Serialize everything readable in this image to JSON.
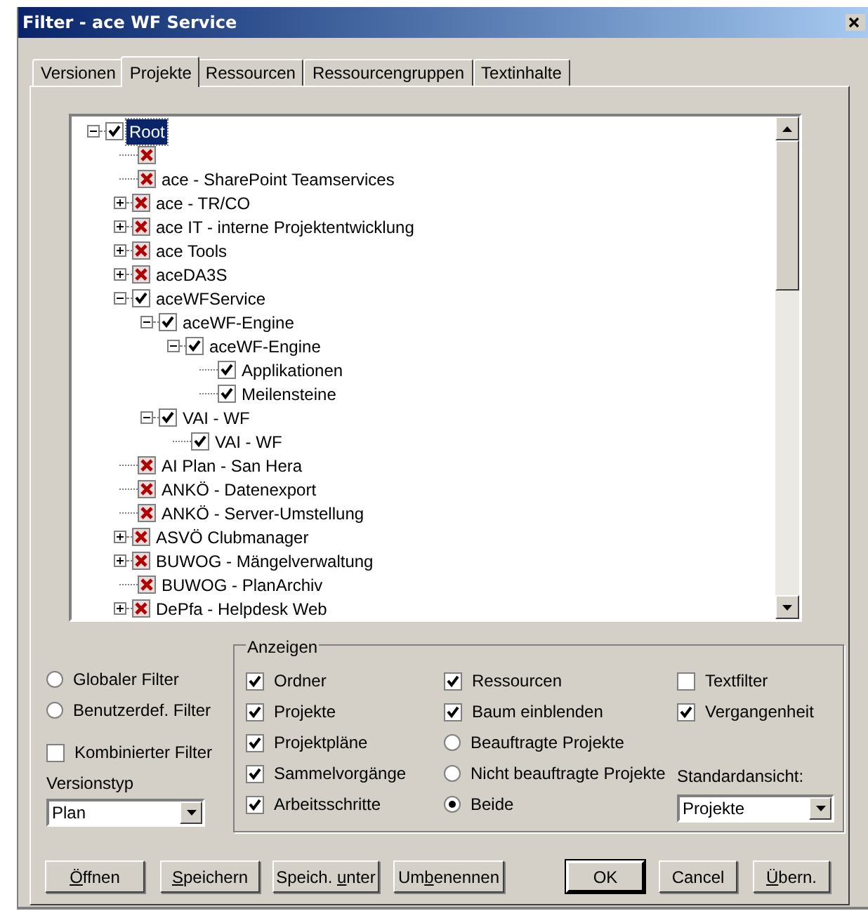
{
  "window": {
    "title": "Filter - ace WF Service"
  },
  "tabs": [
    {
      "label": "Versionen",
      "selected": false
    },
    {
      "label": "Projekte",
      "selected": true
    },
    {
      "label": "Ressourcen",
      "selected": false
    },
    {
      "label": "Ressourcengruppen",
      "selected": false
    },
    {
      "label": "Textinhalte",
      "selected": false
    }
  ],
  "tree": [
    {
      "label": "Root",
      "checked": true,
      "excluded": false,
      "expanded": true,
      "selected": true,
      "children": [
        {
          "checked": false,
          "excluded": true
        },
        {
          "label": "ace - SharePoint Teamservices",
          "checked": false,
          "excluded": true,
          "selected": false
        },
        {
          "label": "ace - TR/CO",
          "checked": false,
          "excluded": true,
          "expanded": false,
          "selected": false
        },
        {
          "label": "ace IT - interne Projektentwicklung",
          "checked": false,
          "excluded": true,
          "expanded": false,
          "selected": false
        },
        {
          "label": "ace Tools",
          "checked": false,
          "excluded": true,
          "expanded": false,
          "selected": false
        },
        {
          "label": "aceDA3S",
          "checked": false,
          "excluded": true,
          "expanded": false,
          "selected": false
        },
        {
          "label": "aceWFService",
          "checked": true,
          "excluded": false,
          "expanded": true,
          "selected": false,
          "children": [
            {
              "label": "aceWF-Engine",
              "checked": true,
              "excluded": false,
              "expanded": true,
              "selected": false,
              "children": [
                {
                  "label": "aceWF-Engine",
                  "checked": true,
                  "excluded": false,
                  "expanded": true,
                  "selected": false,
                  "children": [
                    {
                      "label": "Applikationen",
                      "checked": true,
                      "excluded": false,
                      "selected": false
                    },
                    {
                      "label": "Meilensteine",
                      "checked": true,
                      "excluded": false,
                      "selected": false
                    }
                  ]
                }
              ]
            },
            {
              "label": "VAI - WF",
              "checked": true,
              "excluded": false,
              "expanded": true,
              "selected": false,
              "children": [
                {
                  "label": "VAI - WF",
                  "checked": true,
                  "excluded": false,
                  "selected": false
                }
              ]
            }
          ]
        },
        {
          "label": "AI Plan - San Hera",
          "checked": false,
          "excluded": true,
          "selected": false
        },
        {
          "label": "ANKÖ - Datenexport",
          "checked": false,
          "excluded": true,
          "selected": false
        },
        {
          "label": "ANKÖ - Server-Umstellung",
          "checked": false,
          "excluded": true,
          "selected": false
        },
        {
          "label": "ASVÖ Clubmanager",
          "checked": false,
          "excluded": true,
          "expanded": false,
          "selected": false
        },
        {
          "label": "BUWOG - Mängelverwaltung",
          "checked": false,
          "excluded": true,
          "expanded": false,
          "selected": false
        },
        {
          "label": "BUWOG - PlanArchiv",
          "checked": false,
          "excluded": true,
          "selected": false
        },
        {
          "label": "DePfa - Helpdesk Web",
          "checked": false,
          "excluded": true,
          "expanded": false,
          "selected": false
        }
      ]
    }
  ],
  "left_options": [
    {
      "kind": "radio",
      "label": "Globaler Filter",
      "selected": false
    },
    {
      "kind": "radio",
      "label": "Benutzerdef. Filter",
      "selected": false
    },
    {
      "kind": "checkbox",
      "label": "Kombinierter Filter",
      "checked": false
    },
    {
      "kind": "label",
      "label": "Versionstyp"
    },
    {
      "kind": "select",
      "value": "Plan"
    }
  ],
  "display_group": {
    "title": "Anzeigen",
    "columns": [
      [
        {
          "kind": "checkbox",
          "label": "Ordner",
          "checked": true
        },
        {
          "kind": "checkbox",
          "label": "Projekte",
          "checked": true
        },
        {
          "kind": "checkbox",
          "label": "Projektpläne",
          "checked": true
        },
        {
          "kind": "checkbox",
          "label": "Sammelvorgänge",
          "checked": true
        },
        {
          "kind": "checkbox",
          "label": "Arbeitsschritte",
          "checked": true
        }
      ],
      [
        {
          "kind": "checkbox",
          "label": "Ressourcen",
          "checked": true
        },
        {
          "kind": "checkbox",
          "label": "Baum einblenden",
          "checked": true
        },
        {
          "kind": "radio",
          "label": "Beauftragte Projekte",
          "selected": false
        },
        {
          "kind": "radio",
          "label": "Nicht beauftragte Projekte",
          "selected": false
        },
        {
          "kind": "radio",
          "label": "Beide",
          "selected": true
        }
      ],
      [
        {
          "kind": "checkbox",
          "label": "Textfilter",
          "checked": false
        },
        {
          "kind": "checkbox",
          "label": "Vergangenheit",
          "checked": true
        },
        {
          "kind": "label",
          "label": "Standardansicht:"
        },
        {
          "kind": "select",
          "value": "Projekte"
        }
      ]
    ]
  },
  "buttons": [
    {
      "access_key": "Ö",
      "label_after": "ffnen",
      "default": false
    },
    {
      "access_key": "S",
      "label_after": "peichern",
      "default": false
    },
    {
      "label_before": "Speich. ",
      "access_key": "u",
      "label_after": "nter",
      "default": false
    },
    {
      "label_before": "Um",
      "access_key": "b",
      "label_after": "enennen",
      "default": false
    },
    {
      "label_before": "OK",
      "default": true
    },
    {
      "label_before": "Cancel",
      "default": false
    },
    {
      "access_key": "Ü",
      "label_after": "bern.",
      "default": false
    }
  ]
}
